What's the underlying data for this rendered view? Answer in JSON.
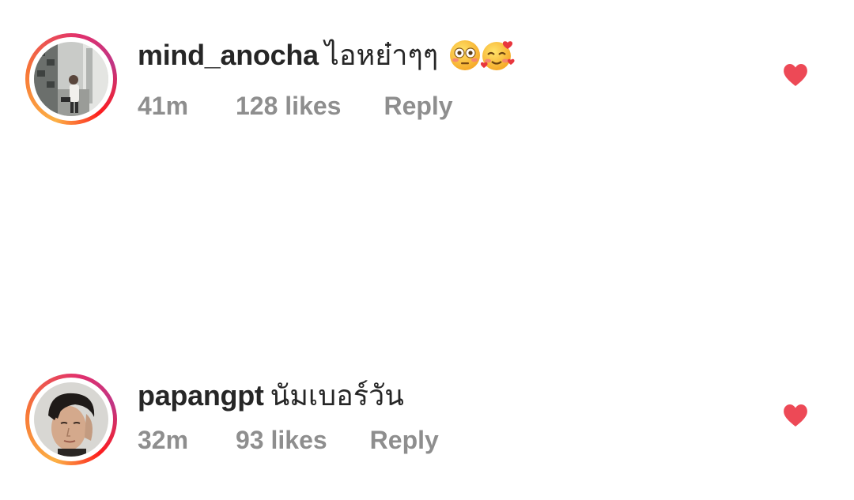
{
  "comments": [
    {
      "username": "mind_anocha",
      "text": "ไอหย๋าๆๆ",
      "emojis": [
        "flushed-face-emoji",
        "smiling-face-with-hearts-emoji"
      ],
      "time": "41m",
      "likes": "128 likes",
      "reply_label": "Reply",
      "liked": true
    },
    {
      "username": "papangpt",
      "text": "นัมเบอร์วัน",
      "emojis": [],
      "time": "32m",
      "likes": "93 likes",
      "reply_label": "Reply",
      "liked": true
    }
  ],
  "colors": {
    "heart": "#ed4956",
    "meta_text": "#8e8e8e",
    "primary_text": "#262626",
    "story_ring_start": "#fcb045",
    "story_ring_end": "#c13584"
  }
}
